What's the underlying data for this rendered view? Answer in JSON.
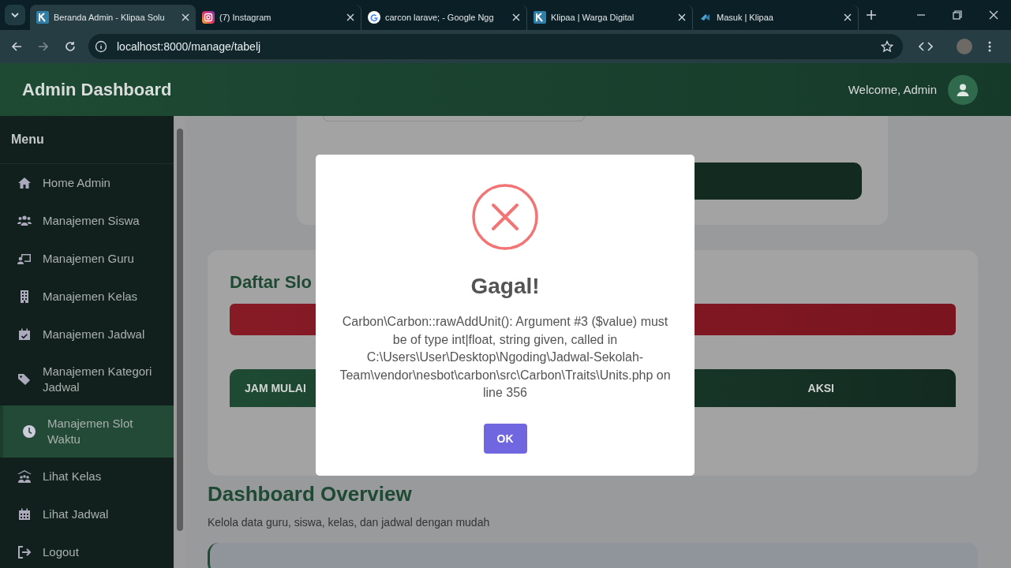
{
  "browser": {
    "tabs": [
      {
        "title": "Beranda Admin - Klipaa Solu",
        "kind": "k-logo",
        "selected": true
      },
      {
        "title": "(7) Instagram",
        "kind": "instagram",
        "selected": false
      },
      {
        "title": "carcon larave; - Google Ngg",
        "kind": "google",
        "selected": false
      },
      {
        "title": "Klipaa | Warga Digital",
        "kind": "k-logo",
        "selected": false
      },
      {
        "title": "Masuk | Klipaa",
        "kind": "k-small",
        "selected": false
      }
    ],
    "url": "localhost:8000/manage/tabelj"
  },
  "header": {
    "title": "Admin Dashboard",
    "welcome": "Welcome, Admin"
  },
  "sidebar": {
    "heading": "Menu",
    "items": [
      {
        "label": "Home Admin",
        "kind": "home",
        "selected": false
      },
      {
        "label": "Manajemen Siswa",
        "kind": "users",
        "selected": false
      },
      {
        "label": "Manajemen Guru",
        "kind": "teacher",
        "selected": false
      },
      {
        "label": "Manajemen Kelas",
        "kind": "building",
        "selected": false
      },
      {
        "label": "Manajemen Jadwal",
        "kind": "calendar-check",
        "selected": false
      },
      {
        "label": "Manajemen Kategori Jadwal",
        "kind": "tag",
        "selected": false
      },
      {
        "label": "Manajemen Slot Waktu",
        "kind": "clock",
        "selected": true
      },
      {
        "label": "Lihat Kelas",
        "kind": "school",
        "selected": false
      },
      {
        "label": "Lihat Jadwal",
        "kind": "calendar",
        "selected": false
      },
      {
        "label": "Logout",
        "kind": "logout",
        "selected": false
      }
    ]
  },
  "slot_card": {
    "title": "Daftar Slo",
    "columns": [
      "JAM MULAI",
      "AKSI"
    ]
  },
  "overview": {
    "title": "Dashboard Overview",
    "subtitle": "Kelola data guru, siswa, kelas, dan jadwal dengan mudah"
  },
  "dialog": {
    "title": "Gagal!",
    "message": "Carbon\\Carbon::rawAddUnit(): Argument #3 ($value) must be of type int|float, string given, called in C:\\Users\\User\\Desktop\\Ngoding\\Jadwal-Sekolah-Team\\vendor\\nesbot\\carbon\\src\\Carbon\\Traits\\Units.php on line 356",
    "button": "OK"
  }
}
